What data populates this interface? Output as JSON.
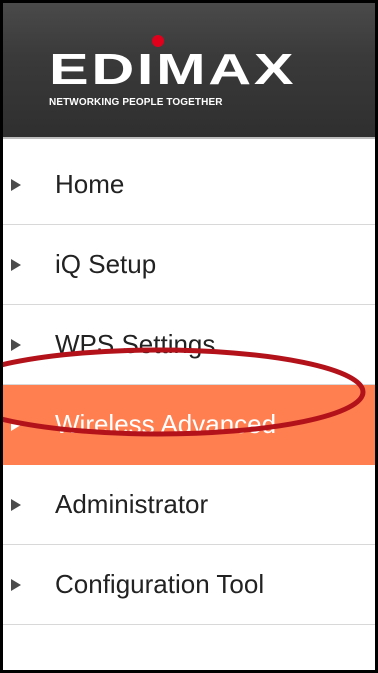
{
  "brand": {
    "logo_text": "EDIMAX",
    "tagline": "NETWORKING PEOPLE TOGETHER",
    "dot_color": "#e0001b"
  },
  "menu": {
    "items": [
      {
        "label": "Home",
        "icon": "triangle-right-icon",
        "active": false
      },
      {
        "label": "iQ Setup",
        "icon": "triangle-right-icon",
        "active": false
      },
      {
        "label": "WPS Settings",
        "icon": "triangle-right-icon",
        "active": false
      },
      {
        "label": "Wireless Advanced",
        "icon": "triangle-right-icon",
        "active": true
      },
      {
        "label": "Administrator",
        "icon": "triangle-right-icon",
        "active": false
      },
      {
        "label": "Configuration Tool",
        "icon": "triangle-right-icon",
        "active": false
      }
    ]
  },
  "colors": {
    "active_background": "#ff7f50",
    "highlight_ring": "#b3121b",
    "header_background": "#3a3a3a"
  }
}
